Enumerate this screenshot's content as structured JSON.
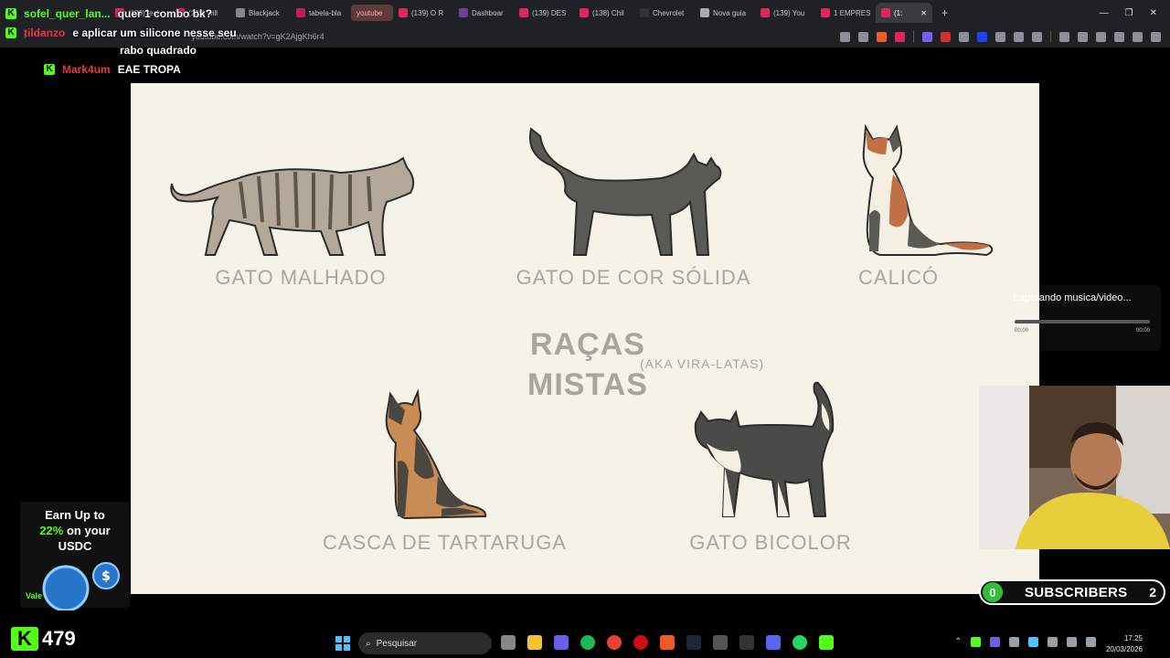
{
  "browser": {
    "tabs": [
      {
        "label": "(139) tech",
        "color": "#e0245e"
      },
      {
        "label": "(139) will",
        "color": "#e0245e"
      },
      {
        "label": "Blackjack",
        "color": "#888888"
      },
      {
        "label": "tabela-bla",
        "color": "#c71c5b"
      },
      {
        "label": "youtube",
        "color": "#ff5555"
      },
      {
        "label": "(139) O R",
        "color": "#e0245e"
      },
      {
        "label": "Dashboar",
        "color": "#6b3fa0"
      },
      {
        "label": "(139) DES",
        "color": "#e0245e"
      },
      {
        "label": "(138) Chil",
        "color": "#e0245e"
      },
      {
        "label": "Chevrolet",
        "color": "#111111"
      },
      {
        "label": "Nova guia",
        "color": "#aaaaaa"
      },
      {
        "label": "(139) You",
        "color": "#e0245e"
      },
      {
        "label": "1 EMPRES",
        "color": "#e0245e"
      },
      {
        "label": "(1:",
        "color": "#e0245e"
      }
    ],
    "url": "youtube.com/watch?v=gK2AjgKh6r4"
  },
  "chat": {
    "messages": [
      {
        "user": "sofel_quer_lan...",
        "user_color": "#53fc18",
        "text": "quer 1 combo bk?"
      },
      {
        "user": "tildanzo",
        "user_color": "#e8344a",
        "text": "e aplicar um silicone nesse seu"
      },
      {
        "user": "",
        "user_color": "#ffffff",
        "text": "rabo quadrado"
      },
      {
        "user": "Mark4um",
        "user_color": "#e8344a",
        "text": "EAE TROPA"
      }
    ]
  },
  "slide": {
    "cats": [
      {
        "caption": "GATO MALHADO"
      },
      {
        "caption": "GATO DE COR SÓLIDA"
      },
      {
        "caption": "CALICÓ"
      },
      {
        "caption": "CASCA DE TARTARUGA"
      },
      {
        "caption": "GATO BICOLOR"
      }
    ],
    "title_line1": "RAÇAS",
    "title_line2": "MISTAS",
    "subtitle": "(AKA VIRA-LATAS)"
  },
  "music": {
    "text": "Esperando musica/video...",
    "time_start": "00:00",
    "time_end": "00:00"
  },
  "subscribers": {
    "left_count": "0",
    "label": "SUBSCRIBERS",
    "right_count": "2"
  },
  "ad": {
    "line1": "Earn Up to",
    "pct": "22%",
    "line2": "on your",
    "line3": "USDC",
    "cta": "Vale"
  },
  "kick": {
    "logo": "K",
    "count": "479"
  },
  "taskbar": {
    "search_placeholder": "Pesquisar",
    "time": "17:25",
    "date": "20/03/2026"
  },
  "colors": {
    "kick_green": "#53fc18",
    "slide_bg": "#f5f2e8"
  }
}
